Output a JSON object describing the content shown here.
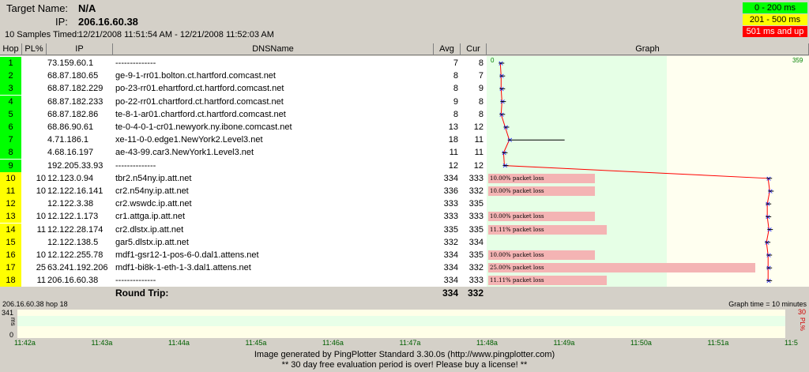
{
  "header": {
    "target_label": "Target Name:",
    "target_value": "N/A",
    "ip_label": "IP:",
    "ip_value": "206.16.60.38",
    "samples_label": "10 Samples Timed:",
    "samples_value": "12/21/2008 11:51:54 AM - 12/21/2008 11:52:03 AM"
  },
  "legend": [
    {
      "label": "0 - 200 ms",
      "color": "#00ff00",
      "text_color": "#000000"
    },
    {
      "label": "201 - 500 ms",
      "color": "#ffff00",
      "text_color": "#000000"
    },
    {
      "label": "501 ms and up",
      "color": "#ff0000",
      "text_color": "#ffffff"
    }
  ],
  "columns": {
    "hop": "Hop",
    "pl": "PL%",
    "ip": "IP",
    "dns": "DNSName",
    "avg": "Avg",
    "cur": "Cur",
    "graph": "Graph"
  },
  "graph_scale_left": "0",
  "graph_scale_right": "359",
  "hops": [
    {
      "hop": "1",
      "pl": "",
      "ip": "73.159.60.1",
      "dns": "--------------",
      "avg": "7",
      "cur": "8",
      "color": "#00ff00",
      "loss": "",
      "loss_frac": 0
    },
    {
      "hop": "2",
      "pl": "",
      "ip": "68.87.180.65",
      "dns": "ge-9-1-rr01.bolton.ct.hartford.comcast.net",
      "avg": "8",
      "cur": "7",
      "color": "#00ff00",
      "loss": "",
      "loss_frac": 0
    },
    {
      "hop": "3",
      "pl": "",
      "ip": "68.87.182.229",
      "dns": "po-23-rr01.ehartford.ct.hartford.comcast.net",
      "avg": "8",
      "cur": "9",
      "color": "#00ff00",
      "loss": "",
      "loss_frac": 0
    },
    {
      "hop": "4",
      "pl": "",
      "ip": "68.87.182.233",
      "dns": "po-22-rr01.chartford.ct.hartford.comcast.net",
      "avg": "9",
      "cur": "8",
      "color": "#00ff00",
      "loss": "",
      "loss_frac": 0
    },
    {
      "hop": "5",
      "pl": "",
      "ip": "68.87.182.86",
      "dns": "te-8-1-ar01.chartford.ct.hartford.comcast.net",
      "avg": "8",
      "cur": "8",
      "color": "#00ff00",
      "loss": "",
      "loss_frac": 0
    },
    {
      "hop": "6",
      "pl": "",
      "ip": "68.86.90.61",
      "dns": "te-0-4-0-1-cr01.newyork.ny.ibone.comcast.net",
      "avg": "13",
      "cur": "12",
      "color": "#00ff00",
      "loss": "",
      "loss_frac": 0
    },
    {
      "hop": "7",
      "pl": "",
      "ip": "4.71.186.1",
      "dns": "xe-11-0-0.edge1.NewYork2.Level3.net",
      "avg": "18",
      "cur": "11",
      "color": "#00ff00",
      "loss": "",
      "loss_frac": 0
    },
    {
      "hop": "8",
      "pl": "",
      "ip": "4.68.16.197",
      "dns": "ae-43-99.car3.NewYork1.Level3.net",
      "avg": "11",
      "cur": "11",
      "color": "#00ff00",
      "loss": "",
      "loss_frac": 0
    },
    {
      "hop": "9",
      "pl": "",
      "ip": "192.205.33.93",
      "dns": "--------------",
      "avg": "12",
      "cur": "12",
      "color": "#00ff00",
      "loss": "",
      "loss_frac": 0
    },
    {
      "hop": "10",
      "pl": "10",
      "ip": "12.123.0.94",
      "dns": "tbr2.n54ny.ip.att.net",
      "avg": "334",
      "cur": "333",
      "color": "#ffff00",
      "loss": "10.00% packet loss",
      "loss_frac": 0.1
    },
    {
      "hop": "11",
      "pl": "10",
      "ip": "12.122.16.141",
      "dns": "cr2.n54ny.ip.att.net",
      "avg": "336",
      "cur": "332",
      "color": "#ffff00",
      "loss": "10.00% packet loss",
      "loss_frac": 0.1
    },
    {
      "hop": "12",
      "pl": "",
      "ip": "12.122.3.38",
      "dns": "cr2.wswdc.ip.att.net",
      "avg": "333",
      "cur": "335",
      "color": "#ffff00",
      "loss": "",
      "loss_frac": 0
    },
    {
      "hop": "13",
      "pl": "10",
      "ip": "12.122.1.173",
      "dns": "cr1.attga.ip.att.net",
      "avg": "333",
      "cur": "333",
      "color": "#ffff00",
      "loss": "10.00% packet loss",
      "loss_frac": 0.1
    },
    {
      "hop": "14",
      "pl": "11",
      "ip": "12.122.28.174",
      "dns": "cr2.dlstx.ip.att.net",
      "avg": "335",
      "cur": "335",
      "color": "#ffff00",
      "loss": "11.11% packet loss",
      "loss_frac": 0.111
    },
    {
      "hop": "15",
      "pl": "",
      "ip": "12.122.138.5",
      "dns": "gar5.dlstx.ip.att.net",
      "avg": "332",
      "cur": "334",
      "color": "#ffff00",
      "loss": "",
      "loss_frac": 0
    },
    {
      "hop": "16",
      "pl": "10",
      "ip": "12.122.255.78",
      "dns": "mdf1-gsr12-1-pos-6-0.dal1.attens.net",
      "avg": "334",
      "cur": "335",
      "color": "#ffff00",
      "loss": "10.00% packet loss",
      "loss_frac": 0.1
    },
    {
      "hop": "17",
      "pl": "25",
      "ip": "63.241.192.206",
      "dns": "mdf1-bi8k-1-eth-1-3.dal1.attens.net",
      "avg": "334",
      "cur": "332",
      "color": "#ffff00",
      "loss": "25.00% packet loss",
      "loss_frac": 0.25
    },
    {
      "hop": "18",
      "pl": "11",
      "ip": "206.16.60.38",
      "dns": "--------------",
      "avg": "334",
      "cur": "333",
      "color": "#ffff00",
      "loss": "11.11% packet loss",
      "loss_frac": 0.111
    }
  ],
  "round_trip": {
    "label": "Round Trip:",
    "avg": "334",
    "cur": "332"
  },
  "timeline": {
    "title": "206.16.60.38 hop 18",
    "graph_time": "Graph time = 10 minutes",
    "y_max": "341",
    "y_min": "0",
    "y_label": "ms",
    "pl_max": "30",
    "pl_label": "PL%",
    "ticks": [
      "11:42a",
      "11:43a",
      "11:44a",
      "11:45a",
      "11:46a",
      "11:47a",
      "11:48a",
      "11:49a",
      "11:50a",
      "11:51a",
      "11:5"
    ]
  },
  "footer": {
    "line1": "Image generated by PingPlotter Standard 3.30.0s (http://www.pingplotter.com)",
    "line2": "** 30 day free evaluation period is over!  Please buy a license! **"
  }
}
